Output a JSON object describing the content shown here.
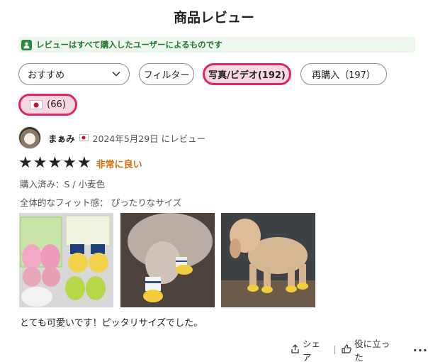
{
  "header": {
    "title": "商品レビュー"
  },
  "banner": {
    "text": "レビューはすべて購入したユーザーによるものです",
    "icon": "verified-user-icon",
    "color": "#2e8b3a"
  },
  "filters": {
    "sort_value": "おすすめ",
    "filter_label": "フィルター",
    "photo_label": "写真/ビデオ(192)",
    "repeat_label": "再購入（197）",
    "country_count": "(66)",
    "accent_color": "#e0246a"
  },
  "review": {
    "reviewer_name": "まぁみ",
    "date": "2024年5月29日 にレビュー",
    "rating": 5,
    "rating_label": "非常に良い",
    "purchased": "購入済み：S / 小麦色",
    "fit": "全体的なフィット感： ぴったりなサイズ",
    "body": "とても可愛いです！ピッタリサイズでした。"
  },
  "actions": {
    "share_label": "シェア",
    "helpful_label": "役に立った",
    "more_icon": "ellipsis-icon"
  }
}
